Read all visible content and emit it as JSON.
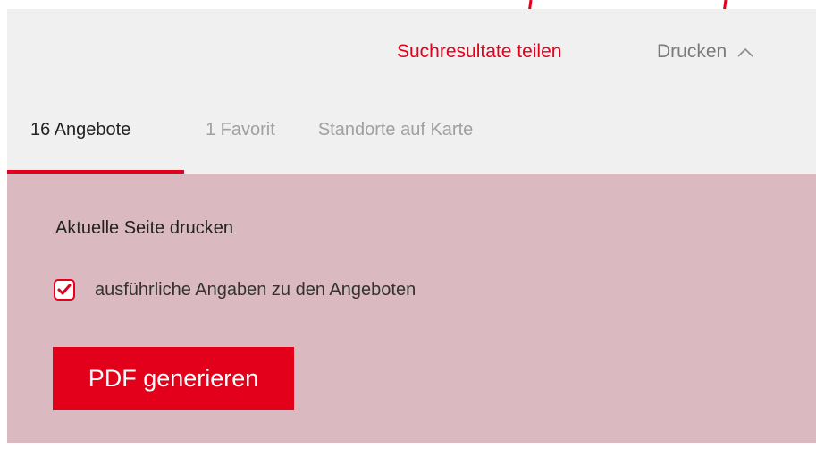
{
  "header": {
    "share_label": "Suchresultate teilen",
    "print_label": "Drucken",
    "print_icon": "chevron-up-icon"
  },
  "tabs": [
    {
      "label": "16 Angebote",
      "active": true
    },
    {
      "label": "1 Favorit",
      "active": false
    },
    {
      "label": "Standorte auf Karte",
      "active": false
    }
  ],
  "print_panel": {
    "heading": "Aktuelle Seite drucken",
    "checkbox_label": "ausführliche Angaben zu den Angeboten",
    "checkbox_checked": true,
    "button_label": "PDF generieren"
  },
  "colors": {
    "accent": "#e3001b",
    "topbar_bg": "#f0f0f0",
    "panel_bg": "#dbb9c0",
    "muted_text": "#a0a0a0"
  }
}
